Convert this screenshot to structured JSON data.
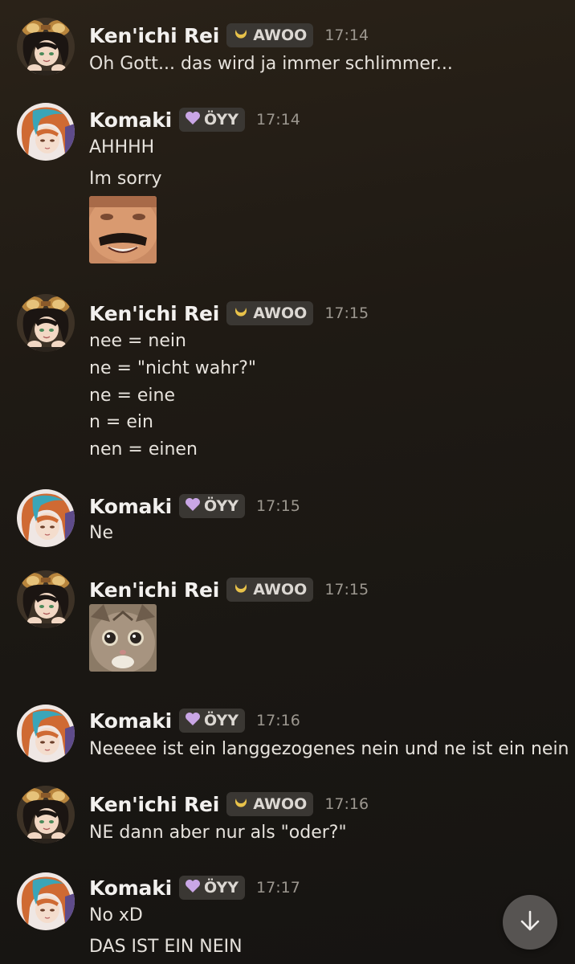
{
  "users": {
    "kenichi": {
      "name": "Ken'ichi Rei",
      "badge": "AWOO",
      "badge_icon": "crescent-moon-icon",
      "badge_icon_color": "#e8c24a"
    },
    "komaki": {
      "name": "Komaki",
      "badge": "ÖYY",
      "badge_icon": "purple-heart-icon",
      "badge_icon_color": "#c9a6e6"
    }
  },
  "messages": [
    {
      "author": "Ken'ichi Rei",
      "badge": "AWOO",
      "time": "17:14",
      "lines": [
        "Oh Gott... das wird ja immer schlimmer..."
      ]
    },
    {
      "author": "Komaki",
      "badge": "ÖYY",
      "time": "17:14",
      "lines": [
        "AHHHH",
        "Im sorry"
      ],
      "attachment": "laughing-man-meme-sticker"
    },
    {
      "author": "Ken'ichi Rei",
      "badge": "AWOO",
      "time": "17:15",
      "lines": [
        "nee = nein",
        "ne = \"nicht wahr?\"",
        "ne = eine",
        "n = ein",
        "nen = einen"
      ]
    },
    {
      "author": "Komaki",
      "badge": "ÖYY",
      "time": "17:15",
      "lines": [
        "Ne"
      ]
    },
    {
      "author": "Ken'ichi Rei",
      "badge": "AWOO",
      "time": "17:15",
      "lines": [],
      "attachment": "shocked-cat-sticker"
    },
    {
      "author": "Komaki",
      "badge": "ÖYY",
      "time": "17:16",
      "lines": [
        "Neeeee ist ein langgezogenes nein und ne ist ein nein"
      ]
    },
    {
      "author": "Ken'ichi Rei",
      "badge": "AWOO",
      "time": "17:16",
      "lines": [
        "NE dann aber nur als \"oder?\""
      ]
    },
    {
      "author": "Komaki",
      "badge": "ÖYY",
      "time": "17:17",
      "lines": [
        "No xD",
        "DAS IST EIN NEIN"
      ]
    }
  ],
  "controls": {
    "scroll_to_bottom_icon": "arrow-down-icon"
  },
  "colors": {
    "background": "#1c1814",
    "badge_bg": "#3a3733",
    "timestamp": "#9c978f",
    "scroll_button": "#575452"
  }
}
